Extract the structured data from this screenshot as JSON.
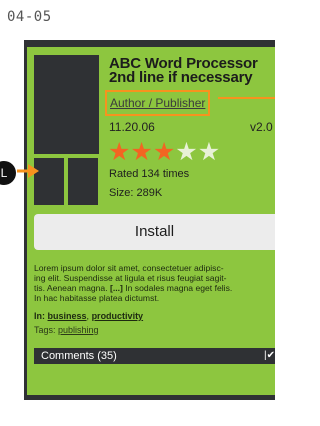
{
  "page_label": "04-05",
  "callout": {
    "label": "L"
  },
  "app": {
    "title_line1": "ABC Word Processor",
    "title_line2": "2nd line if necessary",
    "author": "Author / Publisher",
    "date": "11.20.06",
    "version": "v2.0",
    "rating": 3,
    "rating_max": 5,
    "rated_text": "Rated 134 times",
    "size_text": "Size: 289K"
  },
  "install": {
    "label": "Install"
  },
  "description": {
    "line1": "Lorem ipsum dolor sit amet, consectetuer adipisc-",
    "line2": "ing elit. Suspendisse at ligula et risus feugiat sagit-",
    "line3_a": "tis. Aenean magna. ",
    "line3_more": "[...]",
    "line3_b": " In sodales magna eget felis.",
    "line4": "In hac habitasse platea dictumst."
  },
  "meta": {
    "in_label": "In:",
    "cat1": "business",
    "cat_sep": ",",
    "cat2": "productivity",
    "tags_label": "Tags:",
    "tag1": "publishing"
  },
  "comments": {
    "label": "Comments (35)",
    "chevron": "|✔"
  },
  "colors": {
    "panel_green": "#8dc63f",
    "dark": "#2f3134",
    "star_orange": "#f26522",
    "callout_orange": "#f7931e"
  }
}
